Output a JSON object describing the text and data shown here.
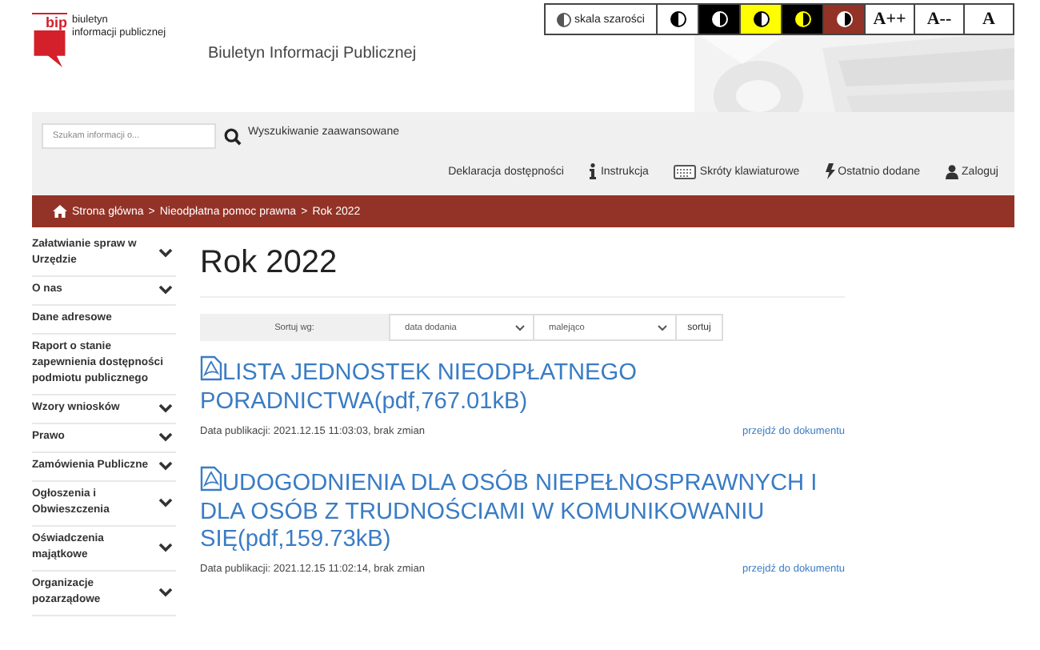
{
  "header": {
    "logo": {
      "mark": "bip",
      "line_1": "biuletyn",
      "line_2": "informacji publicznej"
    },
    "title": "Biuletyn Informacji Publicznej"
  },
  "accessibility": {
    "grayscale": "skala szarości",
    "contrasts": [
      {
        "color": "#ffffff",
        "kind": "dark"
      },
      {
        "color": "#000000",
        "kind": "light"
      },
      {
        "color": "#ffff00",
        "kind": "dark"
      },
      {
        "color": "#000000",
        "kind": "yellow"
      },
      {
        "color": "#933226",
        "kind": "light"
      }
    ],
    "font_sizes": [
      "A++",
      "A--",
      "A"
    ]
  },
  "search": {
    "placeholder": "Szukam informacji o...",
    "advanced": "Wyszukiwanie zaawansowane"
  },
  "top_links": [
    {
      "label": "Deklaracja dostępności",
      "kind": "plain"
    },
    {
      "label": "Instrukcja",
      "kind": "info"
    },
    {
      "label": "Skróty klawiaturowe",
      "kind": "keyboard"
    },
    {
      "label": "Ostatnio dodane",
      "kind": "bolt"
    },
    {
      "label": "Zaloguj",
      "kind": "user"
    }
  ],
  "breadcrumb": {
    "separator": ">",
    "items": [
      "Strona główna",
      "Nieodpłatna pomoc prawna",
      "Rok 2022"
    ]
  },
  "sidebar": {
    "items": [
      {
        "label": "Załatwianie spraw w Urzędzie",
        "kind": "group"
      },
      {
        "label": "O nas",
        "kind": "group"
      },
      {
        "label": "Dane adresowe",
        "kind": "link"
      },
      {
        "label": "Raport o stanie zapewnienia dostępności podmiotu publicznego",
        "kind": "link"
      },
      {
        "label": "Wzory wniosków",
        "kind": "group"
      },
      {
        "label": "Prawo",
        "kind": "group"
      },
      {
        "label": "Zamówienia Publiczne",
        "kind": "group"
      },
      {
        "label": "Ogłoszenia i Obwieszczenia",
        "kind": "group"
      },
      {
        "label": "Oświadczenia majątkowe",
        "kind": "group"
      },
      {
        "label": "Organizacje pozarządowe",
        "kind": "group"
      }
    ]
  },
  "page_title": "Rok 2022",
  "sort": {
    "label": "Sortuj wg:",
    "field": "data dodania",
    "order": "malejąco",
    "button": "sortuj"
  },
  "documents": [
    {
      "title": "LISTA JEDNOSTEK NIEODPŁATNEGO PORADNICTWA(pdf,767.01kB)",
      "meta": "Data publikacji: 2021.12.15 11:03:03, brak zmian",
      "link": "przejdź do dokumentu"
    },
    {
      "title": "UDOGODNIENIA DLA OSÓB NIEPEŁNOSPRAWNYCH I DLA OSÓB Z TRUDNOŚCIAMI W KOMUNIKOWANIU SIĘ(pdf,159.73kB)",
      "meta": "Data publikacji: 2021.12.15 11:02:14, brak zmian",
      "link": "przejdź do dokumentu"
    }
  ]
}
